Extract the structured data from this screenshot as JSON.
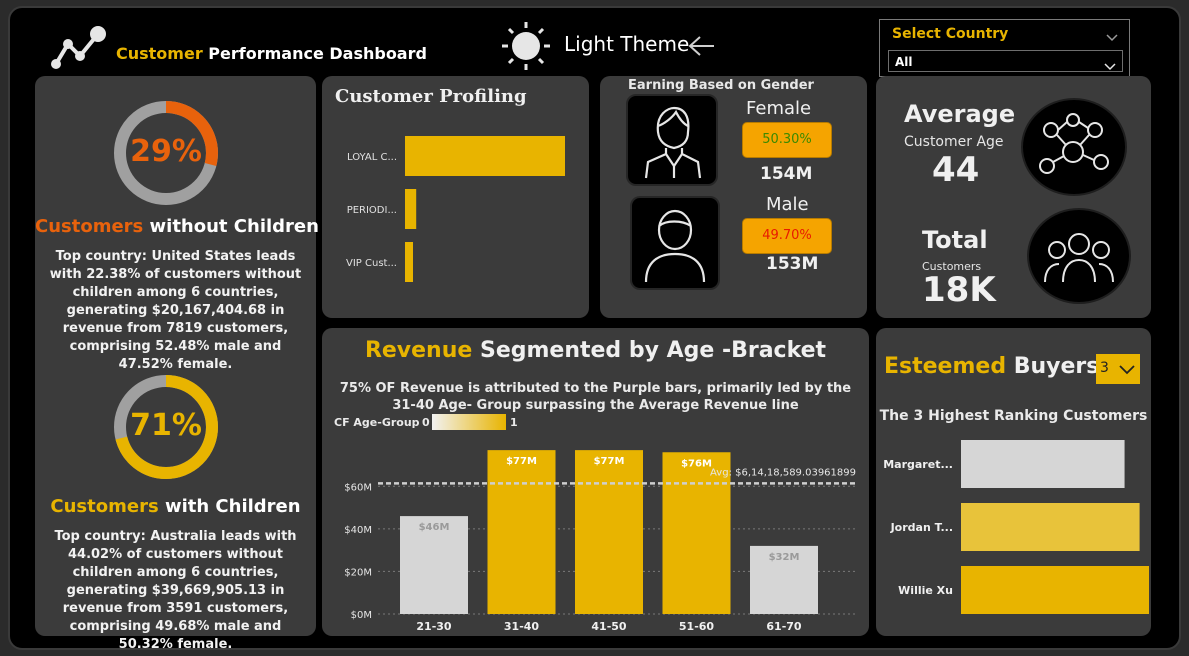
{
  "header": {
    "title_accent": "Customer",
    "title_rest": " Performance Dashboard",
    "theme_label": "Light Theme",
    "country_select": {
      "label": "Select Country",
      "value": "All"
    }
  },
  "left": {
    "without_children": {
      "percent_label": "29%",
      "percent_value": 0.29,
      "title_accent": "Customers",
      "title_rest": " without Children",
      "description": "Top country: United States leads with 22.38% of customers without children among 6 countries, generating $20,167,404.68 in revenue from 7819 customers, comprising 52.48% male and 47.52% female.",
      "color": "#e8620c"
    },
    "with_children": {
      "percent_label": "71%",
      "percent_value": 0.71,
      "title_accent": "Customers",
      "title_rest": " with Children",
      "description": "Top country: Australia leads with 44.02% of customers without children among 6 countries, generating $39,669,905.13 in revenue from 3591 customers, comprising 49.68% male and 50.32% female.",
      "color": "#e8b400"
    }
  },
  "profiling": {
    "title": "Customer Profiling",
    "chart_data": {
      "type": "bar",
      "orientation": "horizontal",
      "categories": [
        "LOYAL C...",
        "PERIODI...",
        "VIP Cust..."
      ],
      "values": [
        1.0,
        0.07,
        0.05
      ],
      "color": "#e8b400"
    }
  },
  "gender": {
    "title": "Earning Based on Gender",
    "female": {
      "label": "Female",
      "percent": "50.30%",
      "value": "154M",
      "pct_color": "#3a8a00"
    },
    "male": {
      "label": "Male",
      "percent": "49.70%",
      "value": "153M",
      "pct_color": "#e81a00"
    }
  },
  "kpis": {
    "avg_age": {
      "title": "Average",
      "subtitle": "Customer Age",
      "value": "44"
    },
    "total": {
      "title": "Total",
      "subtitle": "Customers",
      "value": "18K"
    }
  },
  "revenue": {
    "title_accent": "Revenue",
    "title_rest": " Segmented by Age -Bracket",
    "subtitle_line1": "75% OF Revenue is attributed to the Purple bars, primarily led by the",
    "subtitle_line2": "31-40 Age- Group surpassing the Average Revenue line",
    "legend": {
      "label": "CF Age-Group",
      "min": "0",
      "max": "1"
    },
    "avg_label": "Avg: $6,14,18,589.03961899",
    "chart_data": {
      "type": "bar",
      "categories": [
        "21-30",
        "31-40",
        "41-50",
        "51-60",
        "61-70"
      ],
      "values": [
        46,
        77,
        77,
        76,
        32
      ],
      "data_labels": [
        "$46M",
        "$77M",
        "$77M",
        "$76M",
        "$32M"
      ],
      "above_avg": [
        false,
        true,
        true,
        true,
        false
      ],
      "average": 61.4,
      "ylim": [
        0,
        78
      ],
      "yticks": [
        0,
        20,
        40,
        60
      ],
      "ytick_labels": [
        "$0M",
        "$20M",
        "$40M",
        "$60M"
      ],
      "colors": {
        "above": "#e8b400",
        "below": "#d6d6d6"
      }
    }
  },
  "buyers": {
    "title_accent": "Esteemed",
    "title_rest": " Buyers",
    "n_select": "3",
    "subtitle": "The 3 Highest Ranking Customers",
    "chart_data": {
      "type": "bar",
      "orientation": "horizontal",
      "categories": [
        "Margaret...",
        "Jordan T...",
        "Willie Xu"
      ],
      "values": [
        0.87,
        0.95,
        1.0
      ],
      "colors": [
        "#d6d6d6",
        "#e8c33a",
        "#e8b400"
      ]
    }
  }
}
